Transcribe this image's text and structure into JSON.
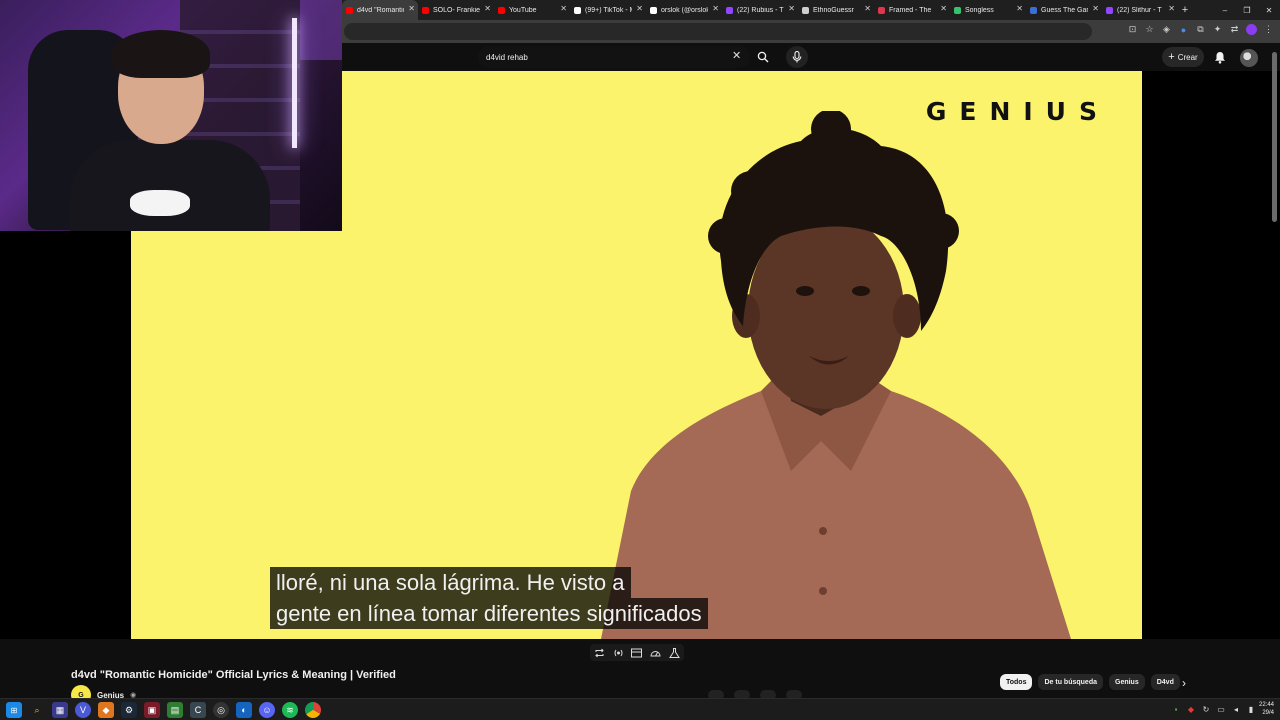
{
  "browser": {
    "tabs": [
      {
        "label": "d4vd \"Romantic",
        "icon": "youtube-icon",
        "color": "#ff0000",
        "active": true
      },
      {
        "label": "SOLO- Frankie",
        "icon": "youtube-icon",
        "color": "#ff0000"
      },
      {
        "label": "YouTube",
        "icon": "youtube-icon",
        "color": "#ff0000"
      },
      {
        "label": "(99+) TikTok - M",
        "icon": "tiktok-icon",
        "color": "#ffffff"
      },
      {
        "label": "orslok (@orslok",
        "icon": "tiktok-icon",
        "color": "#ffffff"
      },
      {
        "label": "(22) Rubius - T",
        "icon": "twitch-icon",
        "color": "#9146ff"
      },
      {
        "label": "EthnoGuessr",
        "icon": "globe-icon",
        "color": "#cfcfcf"
      },
      {
        "label": "Framed - The",
        "icon": "film-icon",
        "color": "#e0364b"
      },
      {
        "label": "Songless",
        "icon": "music-icon",
        "color": "#35c46a"
      },
      {
        "label": "Guess The Gan",
        "icon": "game-icon",
        "color": "#3b6fd6"
      },
      {
        "label": "(22) Slithur - T",
        "icon": "twitch-icon",
        "color": "#9146ff"
      }
    ],
    "new_tab": "+",
    "window_controls": {
      "minimize": "–",
      "maximize": "❐",
      "close": "✕"
    }
  },
  "youtube": {
    "search_value": "d4vid rehab",
    "create_label": "Crear"
  },
  "video": {
    "brand": "GENIUS",
    "subtitles": [
      "lloré, ni una sola lágrima. He visto a",
      "gente en línea tomar diferentes significados"
    ]
  },
  "info": {
    "title": "d4vd \"Romantic Homicide\" Official Lyrics & Meaning | Verified",
    "channel_name": "Genius",
    "channel_avatar_text": "G"
  },
  "chips": [
    "Todos",
    "De tu búsqueda",
    "Genius",
    "D4vd"
  ],
  "taskbar": {
    "time": "22:44",
    "date": "29/4"
  }
}
